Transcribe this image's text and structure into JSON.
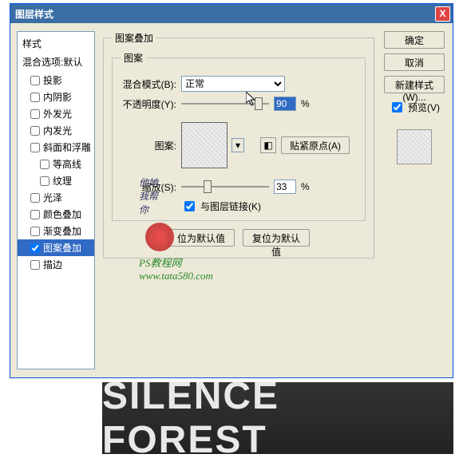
{
  "dialog": {
    "title": "图层样式",
    "close": "X"
  },
  "left": {
    "styles_heading": "样式",
    "blending_heading": "混合选项:默认",
    "items": [
      {
        "label": "投影",
        "checked": false
      },
      {
        "label": "内阴影",
        "checked": false
      },
      {
        "label": "外发光",
        "checked": false
      },
      {
        "label": "内发光",
        "checked": false
      },
      {
        "label": "斜面和浮雕",
        "checked": false
      },
      {
        "label": "等高线",
        "checked": false,
        "indent": true
      },
      {
        "label": "纹理",
        "checked": false,
        "indent": true
      },
      {
        "label": "光泽",
        "checked": false
      },
      {
        "label": "颜色叠加",
        "checked": false
      },
      {
        "label": "渐变叠加",
        "checked": false
      },
      {
        "label": "图案叠加",
        "checked": true,
        "selected": true
      },
      {
        "label": "描边",
        "checked": false
      }
    ]
  },
  "middle": {
    "group_title": "图案叠加",
    "subgroup_title": "图案",
    "blend_mode_label": "混合模式(B):",
    "blend_mode_value": "正常",
    "opacity_label": "不透明度(Y):",
    "opacity_value": "90",
    "opacity_unit": "%",
    "pattern_label": "图案:",
    "snap_origin": "贴紧原点(A)",
    "scale_label": "缩放(S):",
    "scale_value": "33",
    "scale_unit": "%",
    "link_label": "与图层链接(K)",
    "make_default": "位为默认值",
    "reset_default": "复位为默认值"
  },
  "right": {
    "ok": "确定",
    "cancel": "取消",
    "new_style": "新建样式(W)...",
    "preview": "预览(V)"
  },
  "watermark": {
    "line1": "他她",
    "line2": "我帮",
    "line3": "你",
    "site1": "PS教程网",
    "site2": "www.tata580.com"
  },
  "bottom_text": "SILENCE FOREST"
}
